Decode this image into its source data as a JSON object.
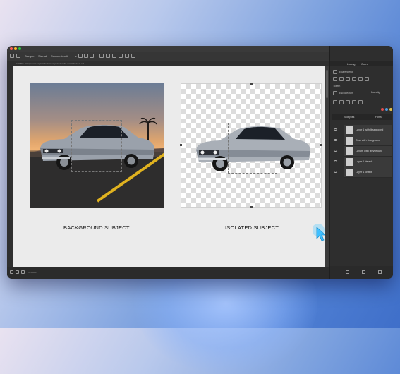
{
  "window": {
    "dots": [
      "#ff5f57",
      "#febc2e",
      "#28c840"
    ]
  },
  "menubar": {
    "items": [
      "Ssegne",
      "Siseral",
      "Eanccesteotti"
    ]
  },
  "options_bar": {
    "text": "Seakithiv traveyc veur sepresshutie ceon paceunasdie mertis bruvent oui"
  },
  "canvas": {
    "left_caption": "BACKGROUND SUBJECT",
    "right_caption": "ISOLATED SUBJECT"
  },
  "status": {
    "zoom": "○ ——"
  },
  "panel": {
    "tabs": [
      "Loseng",
      "Gozre"
    ],
    "row1": "Eoarenperoe",
    "row2": "Tosem",
    "row3": "Escocleotom",
    "row3b": "Eaesitig",
    "layers_header": "Sioeyoes",
    "layers_header_b": "Fomst",
    "layers": [
      "Layor 1 with Ibseground",
      "Coer with Ibseground",
      "Layum with Ibeyground",
      "Layer 1 deteck",
      "Layer 1 losteit"
    ],
    "swatch_colors": [
      "#e34c4c",
      "#4c9be3",
      "#e3c34c"
    ]
  }
}
